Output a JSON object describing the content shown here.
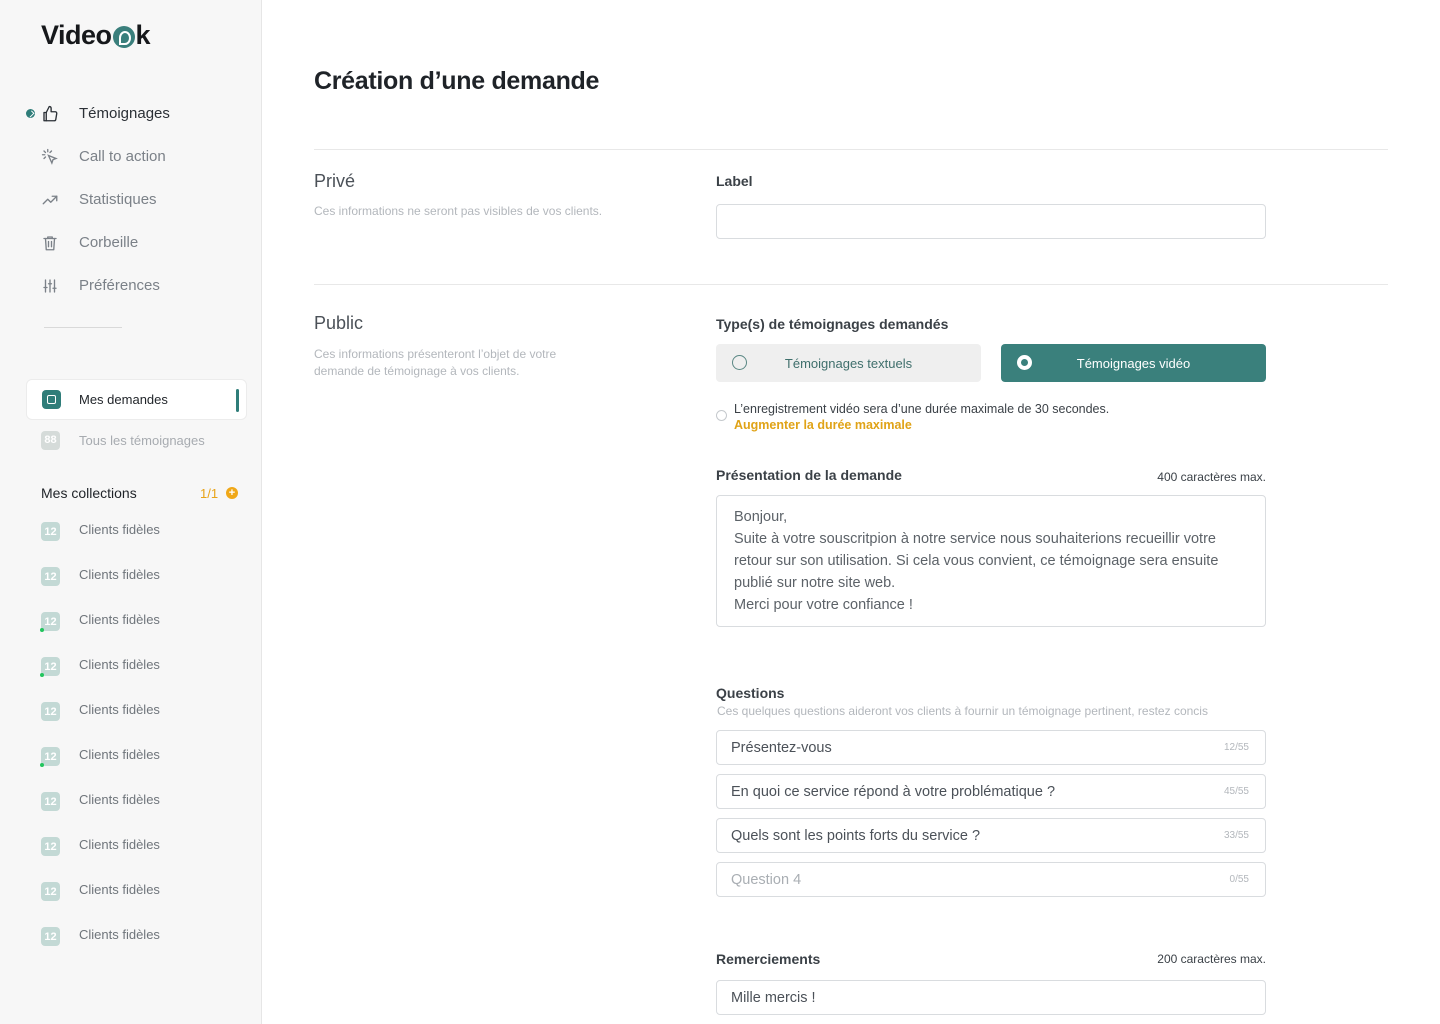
{
  "app": {
    "logo_text_a": "Video",
    "logo_text_b": "k"
  },
  "sidebar": {
    "nav": [
      {
        "label": "Témoignages",
        "icon": "thumbs-up-icon",
        "active": true
      },
      {
        "label": "Call to action",
        "icon": "cursor-click-icon"
      },
      {
        "label": "Statistiques",
        "icon": "trending-up-icon"
      },
      {
        "label": "Corbeille",
        "icon": "trash-icon"
      },
      {
        "label": "Préférences",
        "icon": "sliders-icon"
      }
    ],
    "my_requests": "Mes demandes",
    "all_testimonials": {
      "count": "88",
      "label": "Tous les témoignages"
    },
    "collections_title": "Mes collections",
    "collections_count": "1/1",
    "collections": [
      {
        "count": "12",
        "label": "Clients fidèles"
      },
      {
        "count": "12",
        "label": "Clients fidèles"
      },
      {
        "count": "12",
        "label": "Clients fidèles"
      },
      {
        "count": "12",
        "label": "Clients fidèles"
      },
      {
        "count": "12",
        "label": "Clients fidèles"
      },
      {
        "count": "12",
        "label": "Clients fidèles"
      },
      {
        "count": "12",
        "label": "Clients fidèles"
      },
      {
        "count": "12",
        "label": "Clients fidèles"
      },
      {
        "count": "12",
        "label": "Clients fidèles"
      },
      {
        "count": "12",
        "label": "Clients fidèles"
      }
    ]
  },
  "main": {
    "title": "Création d’une demande",
    "private": {
      "title": "Privé",
      "desc": "Ces informations ne seront pas visibles de vos clients.",
      "label_field": "Label",
      "label_value": ""
    },
    "public": {
      "title": "Public",
      "desc": "Ces informations présenteront l’objet de votre demande de témoignage à vos clients.",
      "types_label": "Type(s) de témoignages demandés",
      "type_text": "Témoignages textuels",
      "type_video": "Témoignages vidéo",
      "video_info": "L’enregistrement vidéo sera d’une durée maximale de 30 secondes.",
      "video_link": "Augmenter la durée maximale",
      "presentation_label": "Présentation de la demande",
      "presentation_hint": "400 caractères max.",
      "presentation_value": "Bonjour,\nSuite à votre souscritpion à notre service nous souhaiterions recueillir votre retour sur son utilisation. Si cela vous convient, ce témoignage sera ensuite publié sur notre site web.\nMerci pour votre confiance !",
      "questions_label": "Questions",
      "questions_sub": "Ces quelques questions aideront vos clients à fournir un témoignage pertinent, restez concis",
      "questions": [
        {
          "value": "Présentez-vous",
          "counter": "12/55"
        },
        {
          "value": "En quoi ce service répond à votre problématique ?",
          "counter": "45/55"
        },
        {
          "value": "Quels sont les points forts du service ?",
          "counter": "33/55"
        },
        {
          "value": "Question 4",
          "counter": "0/55"
        }
      ],
      "thanks_label": "Remerciements",
      "thanks_hint": "200 caractères max.",
      "thanks_value": "Mille mercis !"
    }
  },
  "colors": {
    "accent": "#3a807c",
    "warning": "#e8a317"
  }
}
